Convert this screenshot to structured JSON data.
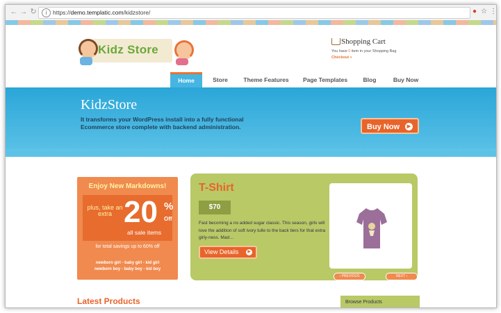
{
  "browser": {
    "url_prefix": "https://",
    "url_host": "demo.templatic.com",
    "url_path": "/kidzstore/"
  },
  "logo": {
    "text": "Kidz Store"
  },
  "cart": {
    "title": "Shopping Cart",
    "line_before": "You have",
    "count": "0",
    "line_after": "item in your Shopping Bag",
    "checkout": "Checkout »"
  },
  "nav": {
    "items": [
      {
        "label": "Home"
      },
      {
        "label": "Store"
      },
      {
        "label": "Theme Features"
      },
      {
        "label": "Page Templates"
      },
      {
        "label": "Blog"
      },
      {
        "label": "Buy Now"
      }
    ]
  },
  "hero": {
    "title": "KidzStore",
    "subtitle": "It transforms your WordPress install into a fully functional Ecommerce store complete with backend administration.",
    "button": "Buy Now"
  },
  "promo": {
    "heading": "Enjoy New Markdowns!",
    "plus": "plus, take an extra",
    "big": "20",
    "pct": "%",
    "off": "Off",
    "sale": "all sale items",
    "total": "for total savings up to 60% off",
    "cats_line1": "newborn girl  -  baby girl   -  kid girl",
    "cats_line2": "newborn boy  -  baby boy   -  kid boy"
  },
  "product": {
    "title": "T-Shirt",
    "price": "$70",
    "description": "Fast becoming a no added sugar classic. This season, girls will love the addition of soft ivory tulle to the back tiers for that extra girly-ness. Mad…",
    "button": "View Details",
    "prev": "‹ PREVIOUS",
    "next": "NEXT ›"
  },
  "latest": {
    "title": "Latest Products"
  },
  "browse": {
    "label": "Browse Products"
  },
  "colors": {
    "accent_orange": "#e8642a",
    "hero_blue": "#46b5e2",
    "product_green": "#b8c966"
  },
  "icons": [
    "back-arrow-icon",
    "forward-arrow-icon",
    "reload-icon",
    "info-icon",
    "extension-icon",
    "star-icon",
    "menu-dots-icon",
    "cart-icon",
    "arrow-circle-icon",
    "tshirt-icon"
  ]
}
